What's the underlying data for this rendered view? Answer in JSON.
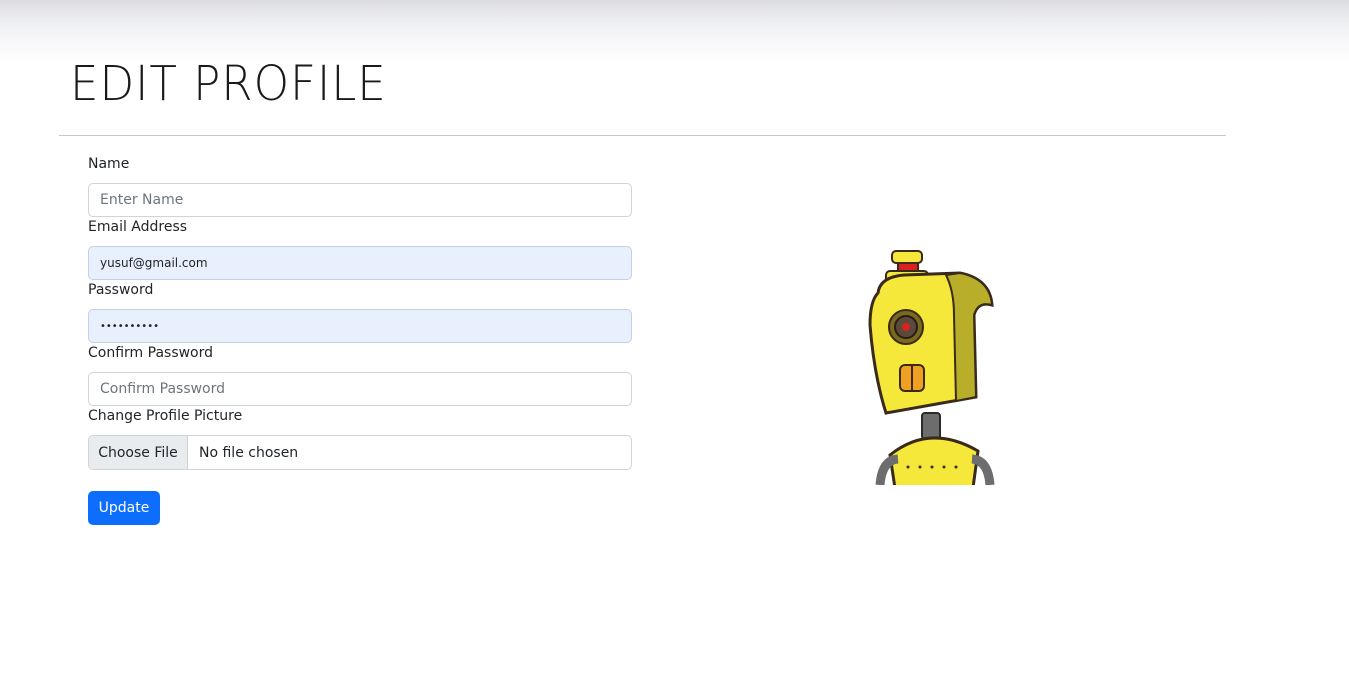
{
  "page": {
    "title": "EDIT PROFILE"
  },
  "form": {
    "name": {
      "label": "Name",
      "placeholder": "Enter Name",
      "value": ""
    },
    "email": {
      "label": "Email Address",
      "value": "yusuf@gmail.com"
    },
    "password": {
      "label": "Password",
      "value": "••••••••••"
    },
    "confirm_password": {
      "label": "Confirm Password",
      "placeholder": "Confirm Password",
      "value": ""
    },
    "profile_picture": {
      "label": "Change Profile Picture",
      "button_label": "Choose File",
      "status": "No file chosen"
    },
    "submit_label": "Update"
  },
  "colors": {
    "primary": "#0d6efd",
    "autofill_bg": "#e8f0fe",
    "robot_yellow": "#f5e83a"
  }
}
